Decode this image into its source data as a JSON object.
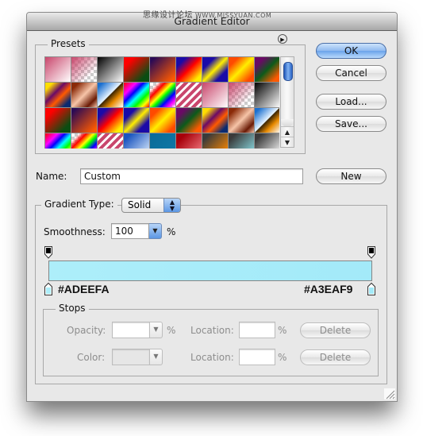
{
  "window": {
    "title": "Gradient Editor",
    "watermark": "思缘设计论坛",
    "watermark_site": "WWW.MISSYUAN.COM"
  },
  "presets": {
    "label": "Presets",
    "menu_icon": "play-circle-icon",
    "swatches": [
      {
        "name": "foreground-to-background",
        "css": "linear-gradient(135deg,#c9466c,#ffffff)"
      },
      {
        "name": "foreground-to-transparent",
        "css": "linear-gradient(135deg,#c9466c,rgba(201,70,108,0) 75%)",
        "checker": true
      },
      {
        "name": "black-white",
        "css": "linear-gradient(135deg,#000000,#ffffff)"
      },
      {
        "name": "red-green",
        "css": "linear-gradient(135deg,#ff0000 20%,#0a4d12 80%)"
      },
      {
        "name": "violet-orange",
        "css": "linear-gradient(135deg,#2a0a55 10%,#ff5a00 90%)"
      },
      {
        "name": "blue-red-yellow",
        "css": "linear-gradient(135deg,#1a0aa8 20%,#ff0000 50%,#ffee00 85%)"
      },
      {
        "name": "blue-yellow-blue",
        "css": "linear-gradient(135deg,#1a0aa8 25%,#ffee00 50%,#1a0aa8 75%)"
      },
      {
        "name": "orange-yellow-orange",
        "css": "linear-gradient(135deg,#ff4a00 20%,#ffee00 50%,#ff4a00 85%)"
      },
      {
        "name": "violet-green-orange",
        "css": "linear-gradient(135deg,#6a0a66 20%,#0c5a1a 50%,#ff5a00 85%)"
      },
      {
        "name": "yellow-violet-orange-blue",
        "css": "linear-gradient(135deg,#ffdd00 15%,#6a0a66 40%,#ff5a00 60%,#0a2a70 85%)"
      },
      {
        "name": "copper",
        "css": "linear-gradient(135deg,#8a2a08 15%,#f6c4a8 50%,#6a1a05 80%,#f6c4a8)"
      },
      {
        "name": "chrome",
        "css": "linear-gradient(135deg,#1a6fd0 10%,#e8f4ff 48%,#3a2400 50%,#e88a00 70%,#ffffff)"
      },
      {
        "name": "spectrum",
        "css": "linear-gradient(135deg,#ff0000,#ff00ff 25%,#0000ff 40%,#00ffff 55%,#00ff00 70%,#ffff00 85%,#ff0000)"
      },
      {
        "name": "transparent-rainbow",
        "css": "linear-gradient(135deg,rgba(255,0,0,0) 15%,#ff0000 30%,#ffff00 45%,#00ff00 55%,#0000ff 70%,#ff00ff 85%,rgba(255,0,255,0))",
        "checker": true
      },
      {
        "name": "transparent-stripes",
        "css": "repeating-linear-gradient(135deg,#c9466c 0 4px,#ffffff 4px 7px)"
      },
      {
        "name": "pink-white",
        "css": "linear-gradient(135deg,#c9466c,#ffffff)"
      },
      {
        "name": "pink-transparent",
        "css": "linear-gradient(135deg,#c9466c,rgba(201,70,108,0) 75%)",
        "checker": true
      },
      {
        "name": "black-white-2",
        "css": "linear-gradient(135deg,#000000,#ffffff)"
      },
      {
        "name": "red-green-2",
        "css": "linear-gradient(135deg,#ff0000 20%,#0a4d12 80%)"
      },
      {
        "name": "violet-orange-2",
        "css": "linear-gradient(135deg,#2a0a55 10%,#ff5a00 90%)"
      },
      {
        "name": "blue-red-yellow-2",
        "css": "linear-gradient(135deg,#1a0aa8 20%,#ff0000 50%,#ffee00 85%)"
      },
      {
        "name": "blue-yellow-blue-2",
        "css": "linear-gradient(135deg,#1a0aa8 25%,#ffee00 50%,#1a0aa8 75%)"
      },
      {
        "name": "orange-yellow-orange-2",
        "css": "linear-gradient(135deg,#ff4a00 20%,#ffee00 50%,#ff4a00 85%)"
      },
      {
        "name": "violet-green-orange-2",
        "css": "linear-gradient(135deg,#6a0a66 20%,#0c5a1a 50%,#ff5a00 85%)"
      },
      {
        "name": "yellow-violet-orange-blue-2",
        "css": "linear-gradient(135deg,#ffdd00 15%,#6a0a66 40%,#ff5a00 60%,#0a2a70 85%)"
      },
      {
        "name": "copper-2",
        "css": "linear-gradient(135deg,#8a2a08 15%,#f6c4a8 50%,#6a1a05 80%,#f6c4a8)"
      },
      {
        "name": "chrome-2",
        "css": "linear-gradient(135deg,#1a6fd0 10%,#e8f4ff 48%,#3a2400 50%,#e88a00 70%,#ffffff)"
      },
      {
        "name": "spectrum-2",
        "css": "linear-gradient(135deg,#ff0000,#ff00ff 25%,#0000ff 40%,#00ffff 55%,#00ff00 70%,#ffff00 85%,#ff0000)"
      },
      {
        "name": "transparent-rainbow-2",
        "css": "linear-gradient(135deg,rgba(255,0,0,0) 15%,#ff0000 30%,#ffff00 45%,#00ff00 55%,#0000ff 70%,#ff00ff 85%,rgba(255,0,255,0))",
        "checker": true
      },
      {
        "name": "transparent-stripes-2",
        "css": "repeating-linear-gradient(135deg,#c9466c 0 4px,#ffffff 4px 7px)"
      },
      {
        "name": "blue-light",
        "css": "linear-gradient(135deg,#1a55c0 15%,#c8dcf6 85%)"
      },
      {
        "name": "teal",
        "css": "linear-gradient(135deg,#0a6a98,#0f7aa8)"
      },
      {
        "name": "dark-red",
        "css": "linear-gradient(135deg,#a8000a 20%,#f07a80 90%)"
      },
      {
        "name": "gray-orange",
        "css": "linear-gradient(135deg,#3a3a3a 15%,#ff8a00 90%)"
      },
      {
        "name": "gray-cyan",
        "css": "linear-gradient(135deg,#3a3a3a 15%,#8ad8e0 90%)"
      },
      {
        "name": "gray-white",
        "css": "linear-gradient(135deg,#3a3a3a 15%,#ffffff 95%)"
      }
    ]
  },
  "buttons": {
    "ok": "OK",
    "cancel": "Cancel",
    "load": "Load...",
    "save": "Save...",
    "new": "New"
  },
  "name_field": {
    "label": "Name:",
    "value": "Custom"
  },
  "gradient_type": {
    "label": "Gradient Type:",
    "selected": "Solid"
  },
  "smoothness": {
    "label": "Smoothness:",
    "value": "100",
    "unit": "%"
  },
  "gradient": {
    "start_color": "#ADEEFA",
    "end_color": "#A3EAF9",
    "start_opacity_stop_color": "#000000",
    "end_opacity_stop_color": "#000000"
  },
  "stops": {
    "label": "Stops",
    "opacity_label": "Opacity:",
    "opacity_value": "",
    "opacity_unit": "%",
    "opacity_location_label": "Location:",
    "opacity_location_value": "",
    "opacity_location_unit": "%",
    "opacity_delete": "Delete",
    "color_label": "Color:",
    "color_location_label": "Location:",
    "color_location_value": "",
    "color_location_unit": "%",
    "color_delete": "Delete"
  }
}
